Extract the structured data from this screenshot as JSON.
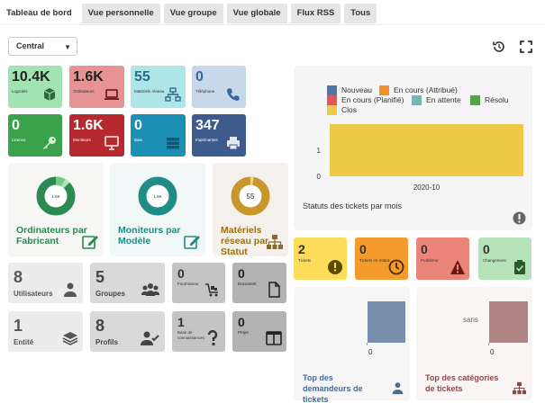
{
  "tabs": [
    {
      "label": "Tableau de bord",
      "active": true
    },
    {
      "label": "Vue personnelle"
    },
    {
      "label": "Vue groupe"
    },
    {
      "label": "Vue globale"
    },
    {
      "label": "Flux RSS"
    },
    {
      "label": "Tous"
    }
  ],
  "entity_select": {
    "value": "Central"
  },
  "stats_top": [
    {
      "value": "10.4K",
      "label": "Logiciels",
      "color": "#a1e4b1",
      "icon": "box-icon"
    },
    {
      "value": "1.6K",
      "label": "Ordinateurs",
      "color": "#e69393",
      "icon": "laptop-icon"
    },
    {
      "value": "55",
      "label": "Matériels réseau",
      "color": "#aee6e8",
      "icon": "network-icon"
    },
    {
      "value": "0",
      "label": "Téléphone",
      "color": "#c6d8ea",
      "icon": "phone-icon"
    },
    {
      "value": "0",
      "label": "Licence",
      "color": "#3aa24a",
      "icon": "key-icon"
    },
    {
      "value": "1.6K",
      "label": "Moniteurs",
      "color": "#b5292f",
      "icon": "monitor-icon"
    },
    {
      "value": "0",
      "label": "Baie",
      "color": "#1c8fb4",
      "icon": "rack-icon"
    },
    {
      "value": "347",
      "label": "Imprimantes",
      "color": "#3d5b8c",
      "icon": "printer-icon"
    }
  ],
  "doughnuts": [
    {
      "title": "Ordinateurs par Fabricant",
      "center": "1.6K",
      "color": "#2a8a4f",
      "bg": "#f6f6f4"
    },
    {
      "title": "Moniteurs par Modèle",
      "center": "1.6K",
      "color": "#1f8c85",
      "bg": "#f2f8f8"
    },
    {
      "title": "Matériels réseau par Statut",
      "center": "55",
      "color": "#c8962a",
      "bg": "#f4f1ec"
    }
  ],
  "grey_cards": [
    {
      "value": "8",
      "label": "Utilisateurs",
      "icon": "user-icon"
    },
    {
      "value": "5",
      "label": "Groupes",
      "icon": "users-icon"
    },
    {
      "value": "0",
      "label": "Fournisseur",
      "icon": "cart-icon"
    },
    {
      "value": "0",
      "label": "Document",
      "icon": "file-icon"
    },
    {
      "value": "1",
      "label": "Entité",
      "icon": "layers-icon"
    },
    {
      "value": "8",
      "label": "Profils",
      "icon": "user-check-icon"
    },
    {
      "value": "1",
      "label": "Base de connaissances",
      "icon": "question-icon"
    },
    {
      "value": "0",
      "label": "Projet",
      "icon": "columns-icon"
    }
  ],
  "chart_panel": {
    "title": "Statuts des tickets par mois",
    "chart_data": {
      "type": "bar",
      "categories": [
        "2020-10"
      ],
      "series": [
        {
          "name": "Nouveau",
          "color": "#4e79a7",
          "values": [
            0
          ]
        },
        {
          "name": "En cours (Attribué)",
          "color": "#f28e2b",
          "values": [
            0
          ]
        },
        {
          "name": "En cours (Planifié)",
          "color": "#e15759",
          "values": [
            0
          ]
        },
        {
          "name": "En attente",
          "color": "#76b7b2",
          "values": [
            0
          ]
        },
        {
          "name": "Résolu",
          "color": "#59a14f",
          "values": [
            0
          ]
        },
        {
          "name": "Clos",
          "color": "#edc948",
          "values": [
            2
          ]
        }
      ],
      "yticks": [
        "1",
        "0"
      ],
      "stacked": true
    }
  },
  "ticket_stats": [
    {
      "value": "2",
      "label": "Tickets",
      "color": "#fddc5c",
      "icon": "exclamation-icon"
    },
    {
      "value": "0",
      "label": "Tickets en retard",
      "color": "#f59b2d",
      "icon": "clock-icon"
    },
    {
      "value": "0",
      "label": "Problème",
      "color": "#ec8579",
      "icon": "warning-icon"
    },
    {
      "value": "0",
      "label": "Changement",
      "color": "#b7e3b8",
      "icon": "clipboard-icon"
    }
  ],
  "bottom_panels": [
    {
      "title": "Top des demandeurs de tickets",
      "bar_label": "",
      "axis": "0",
      "bar_color": "#7890ab",
      "icon": "user-icon"
    },
    {
      "title": "Top des catégories de tickets",
      "bar_label": "sans",
      "axis": "0",
      "bar_color": "#b08384",
      "icon": "sitemap-icon"
    }
  ]
}
